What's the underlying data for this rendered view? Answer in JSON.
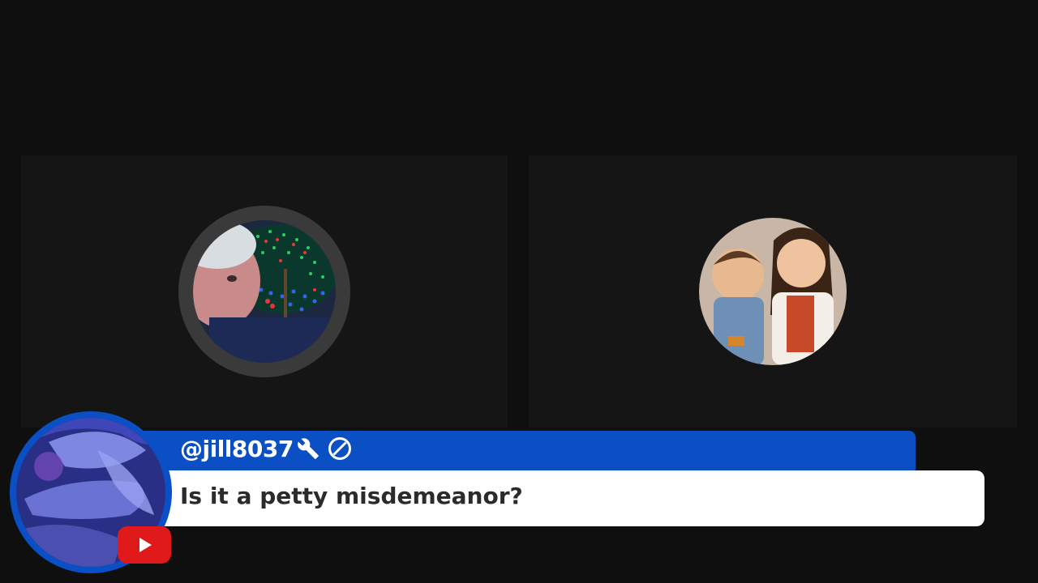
{
  "participants": [
    {
      "id": "left",
      "avatar_icon": "user-photo-icon"
    },
    {
      "id": "right",
      "avatar_icon": "user-photo-icon"
    }
  ],
  "comment": {
    "platform_icon": "youtube-icon",
    "handle": "@jill8037",
    "badges": [
      "wrench-icon",
      "blocked-icon"
    ],
    "message": "Is it a petty misdemeanor?"
  },
  "colors": {
    "background": "#0f0f0f",
    "tile": "#151515",
    "banner_blue": "#0a4fc4",
    "youtube_red": "#e01a1a",
    "message_bg": "#ffffff",
    "message_text": "#2b2b2b"
  }
}
